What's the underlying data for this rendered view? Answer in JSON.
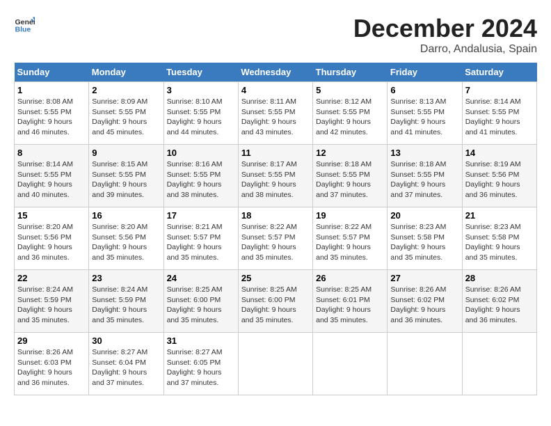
{
  "logo": {
    "general": "General",
    "blue": "Blue"
  },
  "header": {
    "month": "December 2024",
    "location": "Darro, Andalusia, Spain"
  },
  "weekdays": [
    "Sunday",
    "Monday",
    "Tuesday",
    "Wednesday",
    "Thursday",
    "Friday",
    "Saturday"
  ],
  "weeks": [
    [
      {
        "day": "1",
        "sunrise": "8:08 AM",
        "sunset": "5:55 PM",
        "daylight": "9 hours and 46 minutes."
      },
      {
        "day": "2",
        "sunrise": "8:09 AM",
        "sunset": "5:55 PM",
        "daylight": "9 hours and 45 minutes."
      },
      {
        "day": "3",
        "sunrise": "8:10 AM",
        "sunset": "5:55 PM",
        "daylight": "9 hours and 44 minutes."
      },
      {
        "day": "4",
        "sunrise": "8:11 AM",
        "sunset": "5:55 PM",
        "daylight": "9 hours and 43 minutes."
      },
      {
        "day": "5",
        "sunrise": "8:12 AM",
        "sunset": "5:55 PM",
        "daylight": "9 hours and 42 minutes."
      },
      {
        "day": "6",
        "sunrise": "8:13 AM",
        "sunset": "5:55 PM",
        "daylight": "9 hours and 41 minutes."
      },
      {
        "day": "7",
        "sunrise": "8:14 AM",
        "sunset": "5:55 PM",
        "daylight": "9 hours and 41 minutes."
      }
    ],
    [
      {
        "day": "8",
        "sunrise": "8:14 AM",
        "sunset": "5:55 PM",
        "daylight": "9 hours and 40 minutes."
      },
      {
        "day": "9",
        "sunrise": "8:15 AM",
        "sunset": "5:55 PM",
        "daylight": "9 hours and 39 minutes."
      },
      {
        "day": "10",
        "sunrise": "8:16 AM",
        "sunset": "5:55 PM",
        "daylight": "9 hours and 38 minutes."
      },
      {
        "day": "11",
        "sunrise": "8:17 AM",
        "sunset": "5:55 PM",
        "daylight": "9 hours and 38 minutes."
      },
      {
        "day": "12",
        "sunrise": "8:18 AM",
        "sunset": "5:55 PM",
        "daylight": "9 hours and 37 minutes."
      },
      {
        "day": "13",
        "sunrise": "8:18 AM",
        "sunset": "5:55 PM",
        "daylight": "9 hours and 37 minutes."
      },
      {
        "day": "14",
        "sunrise": "8:19 AM",
        "sunset": "5:56 PM",
        "daylight": "9 hours and 36 minutes."
      }
    ],
    [
      {
        "day": "15",
        "sunrise": "8:20 AM",
        "sunset": "5:56 PM",
        "daylight": "9 hours and 36 minutes."
      },
      {
        "day": "16",
        "sunrise": "8:20 AM",
        "sunset": "5:56 PM",
        "daylight": "9 hours and 35 minutes."
      },
      {
        "day": "17",
        "sunrise": "8:21 AM",
        "sunset": "5:57 PM",
        "daylight": "9 hours and 35 minutes."
      },
      {
        "day": "18",
        "sunrise": "8:22 AM",
        "sunset": "5:57 PM",
        "daylight": "9 hours and 35 minutes."
      },
      {
        "day": "19",
        "sunrise": "8:22 AM",
        "sunset": "5:57 PM",
        "daylight": "9 hours and 35 minutes."
      },
      {
        "day": "20",
        "sunrise": "8:23 AM",
        "sunset": "5:58 PM",
        "daylight": "9 hours and 35 minutes."
      },
      {
        "day": "21",
        "sunrise": "8:23 AM",
        "sunset": "5:58 PM",
        "daylight": "9 hours and 35 minutes."
      }
    ],
    [
      {
        "day": "22",
        "sunrise": "8:24 AM",
        "sunset": "5:59 PM",
        "daylight": "9 hours and 35 minutes."
      },
      {
        "day": "23",
        "sunrise": "8:24 AM",
        "sunset": "5:59 PM",
        "daylight": "9 hours and 35 minutes."
      },
      {
        "day": "24",
        "sunrise": "8:25 AM",
        "sunset": "6:00 PM",
        "daylight": "9 hours and 35 minutes."
      },
      {
        "day": "25",
        "sunrise": "8:25 AM",
        "sunset": "6:00 PM",
        "daylight": "9 hours and 35 minutes."
      },
      {
        "day": "26",
        "sunrise": "8:25 AM",
        "sunset": "6:01 PM",
        "daylight": "9 hours and 35 minutes."
      },
      {
        "day": "27",
        "sunrise": "8:26 AM",
        "sunset": "6:02 PM",
        "daylight": "9 hours and 36 minutes."
      },
      {
        "day": "28",
        "sunrise": "8:26 AM",
        "sunset": "6:02 PM",
        "daylight": "9 hours and 36 minutes."
      }
    ],
    [
      {
        "day": "29",
        "sunrise": "8:26 AM",
        "sunset": "6:03 PM",
        "daylight": "9 hours and 36 minutes."
      },
      {
        "day": "30",
        "sunrise": "8:27 AM",
        "sunset": "6:04 PM",
        "daylight": "9 hours and 37 minutes."
      },
      {
        "day": "31",
        "sunrise": "8:27 AM",
        "sunset": "6:05 PM",
        "daylight": "9 hours and 37 minutes."
      },
      null,
      null,
      null,
      null
    ]
  ]
}
